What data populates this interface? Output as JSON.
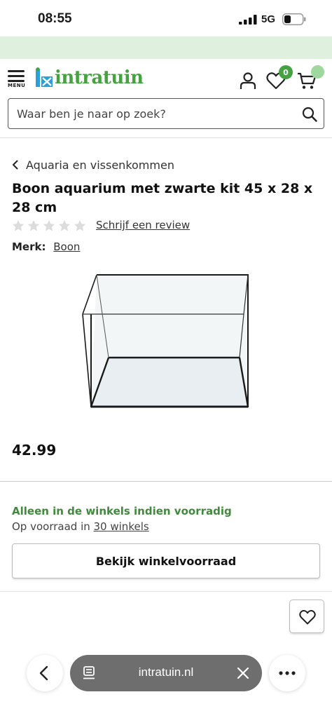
{
  "status_bar": {
    "time": "08:55",
    "network": "5G"
  },
  "header": {
    "menu_label": "MENU",
    "logo_text": "intratuin",
    "favorites_count": "0"
  },
  "search": {
    "placeholder": "Waar ben je naar op zoek?"
  },
  "breadcrumb": {
    "label": "Aquaria en vissenkommen"
  },
  "product": {
    "title": "Boon aquarium met zwarte kit 45 x 28 x 28 cm",
    "rating_stars_filled": 0,
    "rating_stars_total": 5,
    "review_link": "Schrijf een review",
    "brand_label": "Merk:",
    "brand_name": "Boon",
    "price": "42.99"
  },
  "availability": {
    "status": "Alleen in de winkels indien voorradig",
    "count_prefix": "Op voorraad in ",
    "count_link": "30 winkels",
    "store_stock_button": "Bekijk winkelvoorraad"
  },
  "browser": {
    "url": "intratuin.nl"
  },
  "colors": {
    "brand_green": "#44a340",
    "promo_strip": "#dff1de",
    "stock_green": "#3f8a3b",
    "url_pill": "#6e6e6e"
  }
}
